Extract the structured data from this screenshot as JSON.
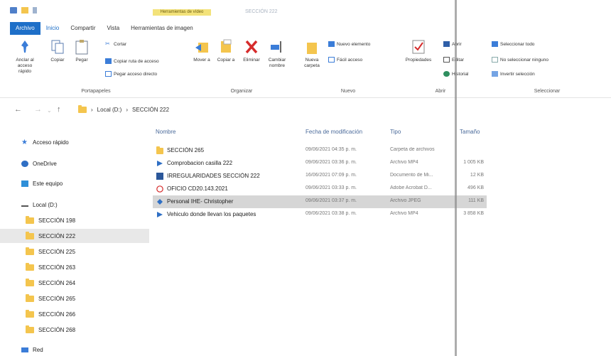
{
  "window": {
    "title_faded": "SECCIÓN 222",
    "tool_badge": "Herramientas de vídeo"
  },
  "ribbon_tabs": [
    {
      "label": "Archivo"
    },
    {
      "label": "Inicio"
    },
    {
      "label": "Compartir"
    },
    {
      "label": "Vista"
    },
    {
      "label": "Herramientas de imagen"
    }
  ],
  "ribbon": {
    "portapapeles": {
      "label": "Portapapeles",
      "anclar": "Anclar al acceso rápido",
      "copiar": "Copiar",
      "pegar": "Pegar",
      "cortar": "Cortar",
      "copiar_ruta": "Copiar ruta de acceso",
      "pegar_acceso": "Pegar acceso directo"
    },
    "organizar": {
      "label": "Organizar",
      "mover": "Mover a",
      "copiar_a": "Copiar a",
      "eliminar": "Eliminar",
      "cambiar_nombre": "Cambiar nombre"
    },
    "nuevo": {
      "label": "Nuevo",
      "nueva_carpeta": "Nueva carpeta",
      "nuevo_elemento": "Nuevo elemento",
      "facil_acceso": "Fácil acceso"
    },
    "abrir": {
      "label": "Abrir",
      "propiedades": "Propiedades",
      "abrir": "Abrir",
      "editar": "Editar",
      "historial": "Historial"
    },
    "seleccionar": {
      "label": "Seleccionar",
      "todo": "Seleccionar todo",
      "nada": "No seleccionar ninguno",
      "invertir": "Invertir selección"
    }
  },
  "address": {
    "drive": "Local (D:)",
    "folder": "SECCIÓN 222"
  },
  "nav": {
    "items": [
      {
        "label": "Acceso rápido",
        "kind": "star"
      },
      {
        "label": "OneDrive",
        "kind": "cloud"
      },
      {
        "label": "Este equipo",
        "kind": "pc"
      },
      {
        "label": "Local (D:)",
        "kind": "drive"
      },
      {
        "label": "SECCIÓN 198",
        "kind": "folder"
      },
      {
        "label": "SECCIÓN 222",
        "kind": "folder",
        "selected": true
      },
      {
        "label": "SECCIÓN 225",
        "kind": "folder"
      },
      {
        "label": "SECCIÓN 263",
        "kind": "folder"
      },
      {
        "label": "SECCIÓN 264",
        "kind": "folder"
      },
      {
        "label": "SECCIÓN 265",
        "kind": "folder"
      },
      {
        "label": "SECCIÓN 266",
        "kind": "folder"
      },
      {
        "label": "SECCIÓN 268",
        "kind": "folder"
      },
      {
        "label": "Red",
        "kind": "net"
      }
    ]
  },
  "list": {
    "columns": {
      "name": "Nombre",
      "date": "Fecha de modificación",
      "type": "Tipo",
      "size": "Tamaño"
    },
    "rows": [
      {
        "name": "SECCIÓN 265",
        "date": "09/06/2021 04:35 p. m.",
        "type": "Carpeta de archivos",
        "size": "",
        "kind": "folder"
      },
      {
        "name": "Comprobacion casilla 222",
        "date": "09/06/2021 03:36 p. m.",
        "type": "Archivo MP4",
        "size": "1 005 KB",
        "kind": "video"
      },
      {
        "name": "IRREGULARIDADES SECCIÓN 222",
        "date": "16/06/2021 07:09 p. m.",
        "type": "Documento de Mi...",
        "size": "12 KB",
        "kind": "word"
      },
      {
        "name": "OFICIO CD20.143.2021",
        "date": "09/06/2021 03:33 p. m.",
        "type": "Adobe Acrobat D...",
        "size": "496 KB",
        "kind": "pdf"
      },
      {
        "name": "Personal IHE- Christopher",
        "date": "09/06/2021 03:37 p. m.",
        "type": "Archivo JPEG",
        "size": "111 KB",
        "kind": "image",
        "selected": true
      },
      {
        "name": "Vehiculo donde llevan los paquetes",
        "date": "09/06/2021 03:38 p. m.",
        "type": "Archivo MP4",
        "size": "3 858 KB",
        "kind": "video"
      }
    ]
  },
  "colors": {
    "accent": "#1e6fc8",
    "folder": "#f4c54e",
    "selection": "#d6d6d6"
  }
}
